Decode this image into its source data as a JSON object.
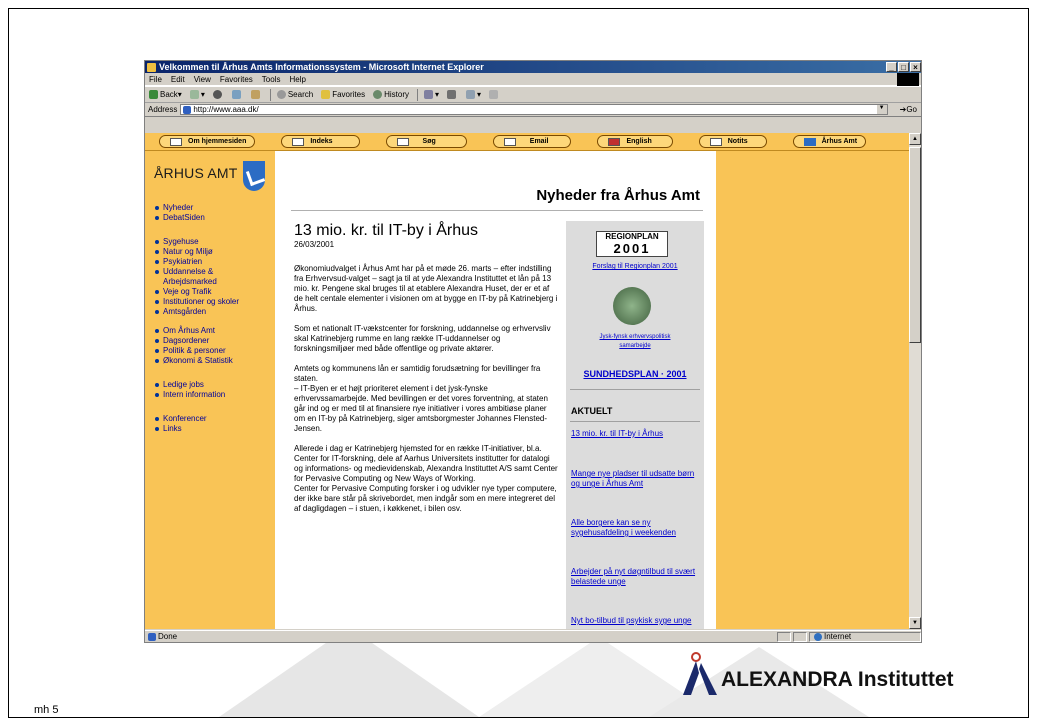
{
  "slide": {
    "number_label": "mh 5",
    "logo_text": "ALEXANDRA Instituttet"
  },
  "browser": {
    "title": "Velkommen til Århus Amts Informationssystem - Microsoft Internet Explorer",
    "menu": [
      "File",
      "Edit",
      "View",
      "Favorites",
      "Tools",
      "Help"
    ],
    "toolbar": {
      "back": "Back",
      "search": "Search",
      "favorites": "Favorites",
      "history": "History"
    },
    "address_label": "Address",
    "url": "http://www.aaa.dk/",
    "go_label": "Go",
    "status": "Done",
    "zone": "Internet"
  },
  "nav": {
    "buttons": [
      "Om hjemmesiden",
      "Indeks",
      "Søg",
      "Email",
      "English",
      "Notits",
      "Århus Amt"
    ]
  },
  "sidebar": {
    "brand": "ÅRHUS AMT",
    "group1": [
      "Nyheder",
      "DebatSiden"
    ],
    "group2": [
      "Sygehuse",
      "Natur og Miljø",
      "Psykiatrien",
      "Uddannelse & Arbejdsmarked",
      "Veje og Trafik",
      "Institutioner og skoler",
      "Amtsgården"
    ],
    "group3": [
      "Om Århus Amt",
      "Dagsordener",
      "Politik & personer",
      "Økonomi & Statistik"
    ],
    "group4": [
      "Ledige jobs",
      "Intern information"
    ],
    "group5": [
      "Konferencer",
      "Links"
    ]
  },
  "content": {
    "page_title": "Nyheder fra Århus Amt",
    "headline": "13 mio. kr. til IT-by i Århus",
    "date": "26/03/2001",
    "paragraphs": [
      "Økonomiudvalget i Århus Amt har på et møde 26. marts – efter indstilling fra Erhvervsud-valget – sagt ja til at yde Alexandra Instituttet et lån på 13 mio. kr. Pengene skal bruges til at etablere Alexandra Huset, der er et af de helt centale elementer i visionen om at bygge en IT-by på Katrinebjerg i Århus.",
      "Som et nationalt IT-vækstcenter for forskning, uddannelse og erhvervsliv skal Katrinebjerg rumme en lang række IT-uddannelser og forskningsmiljøer med både offentlige og private aktører.",
      "Amtets og kommunens lån er samtidig forudsætning for bevillinger fra staten.\n– IT-Byen er et højt prioriteret element i det jysk-fynske erhvervssamarbejde. Med bevillingen er det vores forventning, at staten går ind og er med til at finansiere nye initiativer i vores ambitiøse planer om en IT-by på Katrinebjerg, siger amtsborgmester Johannes Flensted-Jensen.",
      "Allerede i dag er Katrinebjerg hjemsted for en række IT-initiativer, bl.a. Center for IT-forskning, dele af Aarhus Universitets institutter for datalogi og informations- og medievidenskab, Alexandra Instituttet A/S samt Center for Pervasive Computing og New Ways of Working.\nCenter for Pervasive Computing forsker i og udvikler nye typer computere, der ikke bare står på skrivebordet, men indgår som en mere integreret del af dagligdagen – i stuen, i køkkenet, i bilen osv."
    ]
  },
  "rightcol": {
    "regionplan_top": "REGIONPLAN",
    "regionplan_year": "2001",
    "regionplan_link": "Forslag til Regionplan 2001",
    "jysk_link": "Jysk-fynsk erhvervspolitisk samarbejde",
    "sundhed_link": "SUNDHEDSPLAN · 2001",
    "aktuelt": "AKTUELT",
    "news": [
      "13 mio. kr. til IT-by i Århus",
      "Mange nye pladser til udsatte børn og unge i Århus Amt",
      "Alle borgere kan se ny sygehusafdeling i weekenden",
      "Arbejder på nyt døgntilbud til svært belastede unge",
      "Nyt bo-tilbud til psykisk syge unge"
    ]
  }
}
